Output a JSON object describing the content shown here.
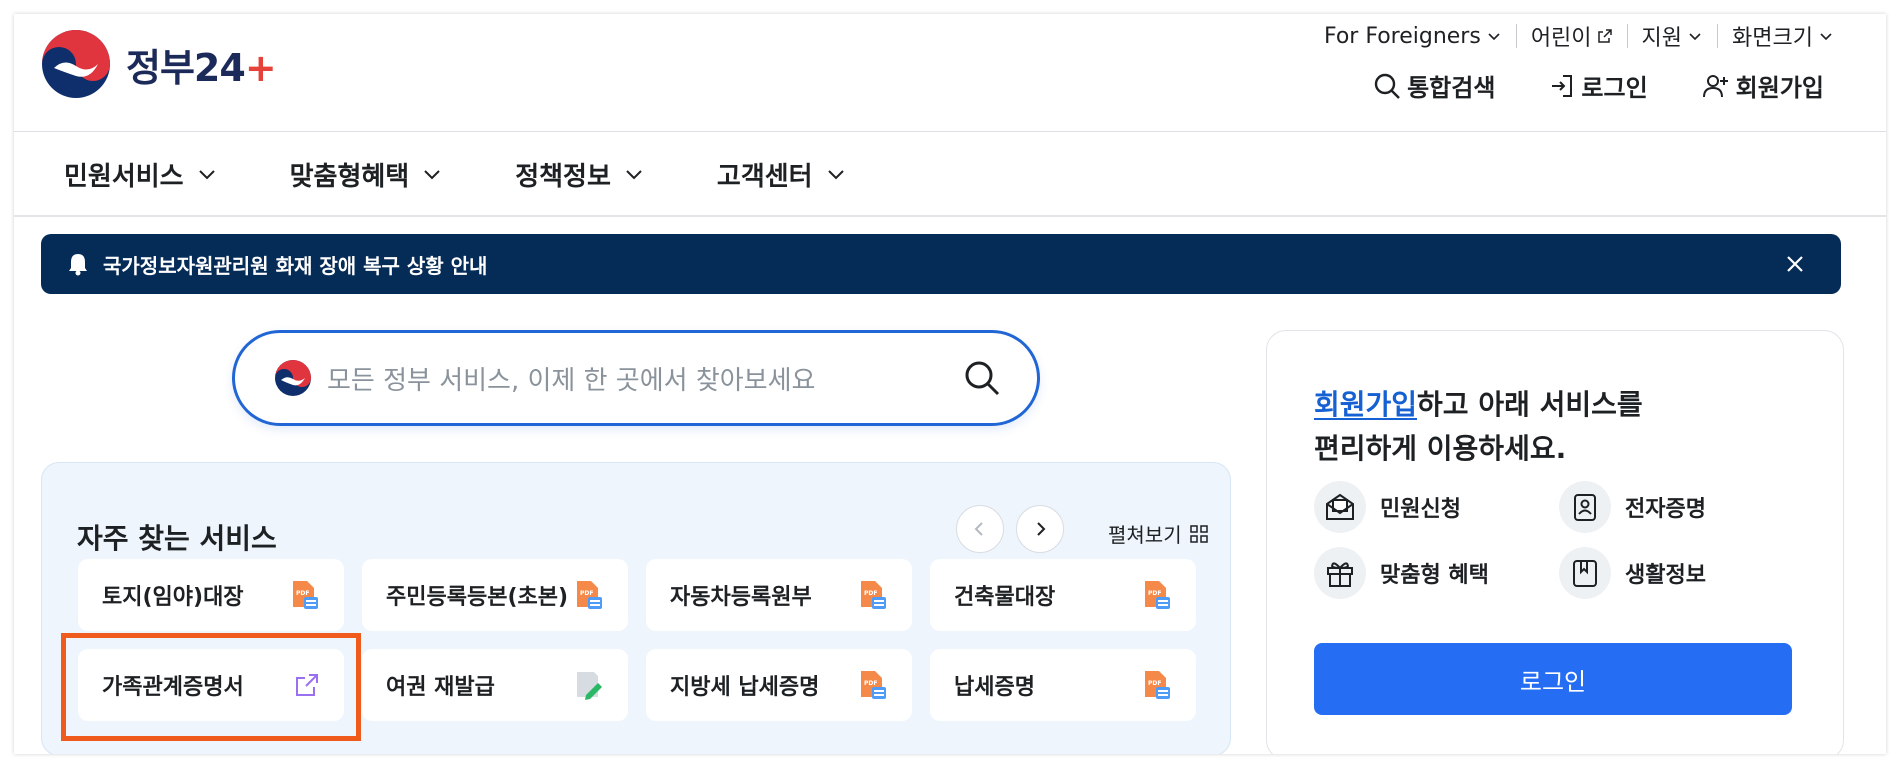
{
  "logo": {
    "text_main": "정부",
    "text_num": "2",
    "text_num2": "4",
    "text_plus": "+"
  },
  "util": {
    "foreigners": "For Foreigners",
    "kids": "어린이",
    "support": "지원",
    "font_size": "화면크기"
  },
  "actions": {
    "search": "통합검색",
    "login": "로그인",
    "signup": "회원가입"
  },
  "nav": [
    {
      "label": "민원서비스"
    },
    {
      "label": "맞춤형혜택"
    },
    {
      "label": "정책정보"
    },
    {
      "label": "고객센터"
    }
  ],
  "notice": {
    "text": "국가정보자원관리원 화재 장애 복구 상황 안내"
  },
  "search": {
    "placeholder": "모든 정부 서비스, 이제 한 곳에서 찾아보세요"
  },
  "frequent": {
    "title": "자주 찾는 서비스",
    "expand_label": "펼쳐보기",
    "items": [
      {
        "label": "토지(임야)대장",
        "icon": "pdf-doc-icon"
      },
      {
        "label": "주민등록등본(초본)",
        "icon": "pdf-doc-icon"
      },
      {
        "label": "자동차등록원부",
        "icon": "pdf-doc-icon"
      },
      {
        "label": "건축물대장",
        "icon": "pdf-doc-icon"
      },
      {
        "label": "가족관계증명서",
        "icon": "external-link-icon"
      },
      {
        "label": "여권 재발급",
        "icon": "edit-doc-icon"
      },
      {
        "label": "지방세 납세증명",
        "icon": "pdf-doc-icon"
      },
      {
        "label": "납세증명",
        "icon": "pdf-doc-icon"
      }
    ]
  },
  "panel": {
    "signup_link": "회원가입",
    "line1_rest": "하고 아래 서비스를",
    "line2": "편리하게 이용하세요.",
    "items": [
      {
        "label": "민원신청",
        "icon": "mail-doc-icon"
      },
      {
        "label": "전자증명",
        "icon": "id-card-icon"
      },
      {
        "label": "맞춤형 혜택",
        "icon": "gift-icon"
      },
      {
        "label": "생활정보",
        "icon": "bookmark-book-icon"
      }
    ],
    "login_button": "로그인"
  },
  "colors": {
    "brand_blue": "#256ef4",
    "notice_bg": "#052b57",
    "highlight": "#ef5b1c",
    "link": "#1560d3"
  }
}
